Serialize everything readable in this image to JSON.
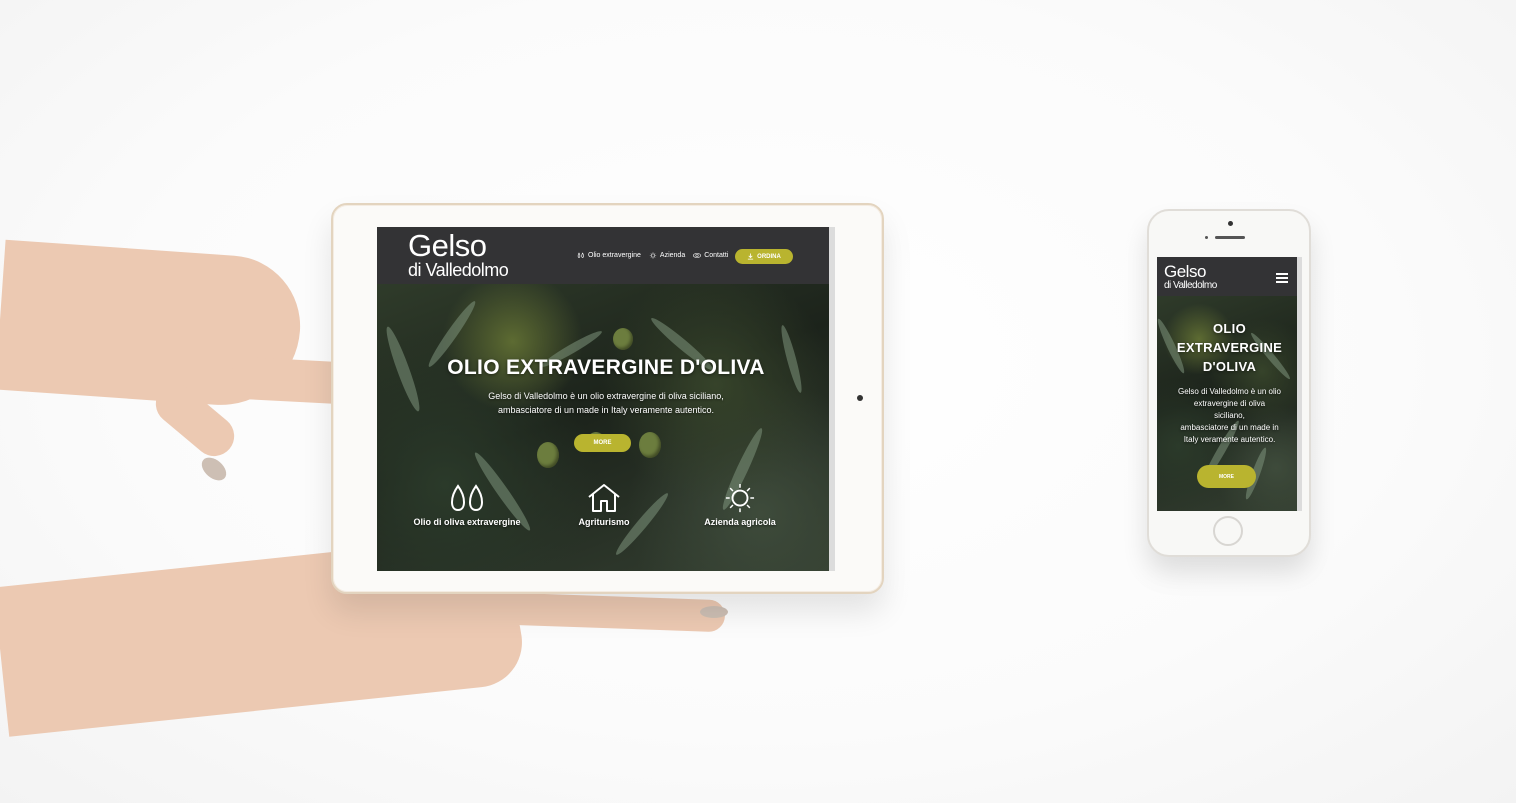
{
  "tablet": {
    "logo_line1": "Gelso",
    "logo_line2": "di Valledolmo",
    "nav": [
      {
        "label": "Olio extravergine",
        "icon": "drops-icon"
      },
      {
        "label": "Azienda",
        "icon": "sun-icon"
      },
      {
        "label": "Contatti",
        "icon": "chat-icon"
      }
    ],
    "order_button": "ORDINA",
    "hero_title": "OLIO EXTRAVERGINE D'OLIVA",
    "hero_text_line1": "Gelso di Valledolmo è un olio extravergine di oliva siciliano,",
    "hero_text_line2": "ambasciatore di un made in Italy veramente autentico.",
    "more_button": "MORE",
    "features": [
      {
        "label": "Olio di oliva extravergine",
        "icon": "drops-icon"
      },
      {
        "label": "Agriturismo",
        "icon": "house-icon"
      },
      {
        "label": "Azienda agricola",
        "icon": "sun-icon"
      }
    ]
  },
  "phone": {
    "logo_line1": "Gelso",
    "logo_line2": "di Valledolmo",
    "hero_title_line1": "OLIO",
    "hero_title_line2": "EXTRAVERGINE",
    "hero_title_line3": "D'OLIVA",
    "hero_text_line1": "Gelso di Valledolmo è un olio",
    "hero_text_line2": "extravergine di oliva",
    "hero_text_line3": "siciliano,",
    "hero_text_line4": "ambasciatore di un made in",
    "hero_text_line5": "Italy veramente autentico.",
    "more_button": "MORE"
  },
  "colors": {
    "header_bg": "#333335",
    "accent": "#b9b42f",
    "text": "#ffffff"
  }
}
